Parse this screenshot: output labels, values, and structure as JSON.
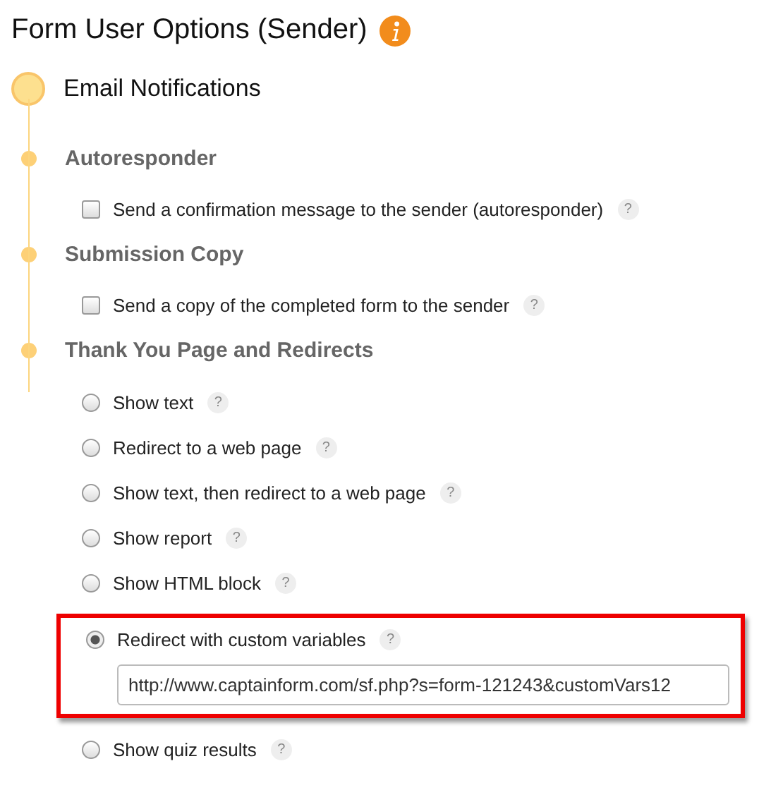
{
  "title": "Form User Options (Sender)",
  "stage": {
    "label": "Email Notifications"
  },
  "sections": [
    {
      "heading": "Autoresponder",
      "kind": "checkbox",
      "options": [
        {
          "label": "Send a confirmation message to the sender (autoresponder)",
          "checked": false,
          "help": "?"
        }
      ]
    },
    {
      "heading": "Submission Copy",
      "kind": "checkbox",
      "options": [
        {
          "label": "Send a copy of the completed form to the sender",
          "checked": false,
          "help": "?"
        }
      ]
    },
    {
      "heading": "Thank You Page and Redirects",
      "kind": "radio",
      "options": [
        {
          "label": "Show text",
          "selected": false,
          "help": "?"
        },
        {
          "label": "Redirect to a web page",
          "selected": false,
          "help": "?"
        },
        {
          "label": "Show text, then redirect to a web page",
          "selected": false,
          "help": "?"
        },
        {
          "label": "Show report",
          "selected": false,
          "help": "?"
        },
        {
          "label": "Show HTML block",
          "selected": false,
          "help": "?"
        },
        {
          "label": "Redirect with custom variables",
          "selected": true,
          "help": "?",
          "highlighted": true,
          "value": "http://www.captainform.com/sf.php?s=form-121243&customVars12"
        },
        {
          "label": "Show quiz results",
          "selected": false,
          "help": "?"
        }
      ]
    }
  ]
}
